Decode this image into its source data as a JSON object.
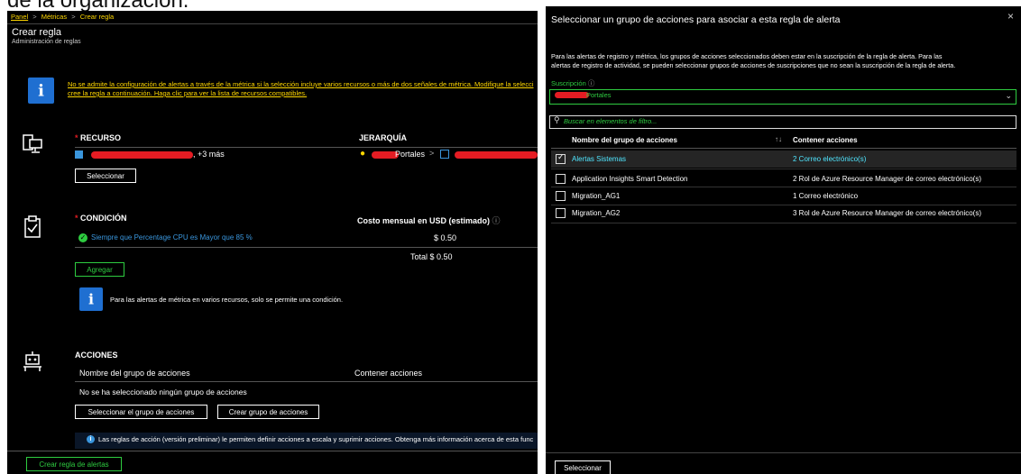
{
  "background_text": "de la organización.",
  "left": {
    "breadcrumb": {
      "panel": "Panel",
      "sep": ">",
      "metricas": "Métricas",
      "crear": "Crear regla"
    },
    "title": "Crear regla",
    "subtitle": "Administración de reglas",
    "info_link_line1": "No se admite la configuración de alertas a través de la métrica si la selección incluye varios recursos o más de dos señales de métrica. Modifique la selecci",
    "info_link_line2": "cree la regla a continuación. Haga clic para ver la lista de recursos compatibles.",
    "resource": {
      "header": "RECURSO",
      "hierarchy_header": "JERARQUÍA",
      "more": ", +3 más",
      "hierarchy_item": "Portales",
      "select_button": "Seleccionar"
    },
    "condition": {
      "header": "CONDICIÓN",
      "cost_header": "Costo mensual en USD (estimado)",
      "condition_text": "Siempre que Percentage CPU es Mayor que 85 %",
      "cost_value": "$ 0.50",
      "total": "Total $ 0.50",
      "add_button": "Agregar",
      "info_text": "Para las alertas de métrica en varios recursos, solo se permite una condición."
    },
    "actions": {
      "header": "ACCIONES",
      "col_name": "Nombre del grupo de acciones",
      "col_contains": "Contener acciones",
      "empty": "No se ha seleccionado ningún grupo de acciones",
      "select_group_button": "Seleccionar el grupo de acciones",
      "create_group_button": "Crear grupo de acciones",
      "note": "Las reglas de acción (versión preliminar) le permiten definir acciones a escala y suprimir acciones. Obtenga más información acerca de esta func"
    },
    "create_button": "Crear regla de alertas"
  },
  "right": {
    "title": "Seleccionar un grupo de acciones para asociar a esta regla de alerta",
    "description_line1": "Para las alertas de registro y métrica, los grupos de acciones seleccionados deben estar en la suscripción de la regla de alerta. Para las",
    "description_line2": "alertas de registro de actividad, se pueden seleccionar grupos de acciones de suscripciones que no sean la suscripción de la regla de alerta.",
    "subscription_label": "Suscripción",
    "subscription_value": "Portales",
    "search_placeholder": "Buscar en elementos de filtro...",
    "col_name": "Nombre del grupo de acciones",
    "col_contains": "Contener acciones",
    "rows": [
      {
        "name": "Alertas Sistemas",
        "actions": "2 Correo electrónico(s)",
        "selected": true
      },
      {
        "name": "Application Insights Smart Detection",
        "actions": "2 Rol de Azure Resource Manager de correo electrónico(s)",
        "selected": false
      },
      {
        "name": "Migration_AG1",
        "actions": "1 Correo electrónico",
        "selected": false
      },
      {
        "name": "Migration_AG2",
        "actions": "3 Rol de Azure Resource Manager de correo electrónico(s)",
        "selected": false
      }
    ],
    "select_button": "Seleccionar",
    "close_glyph": "×"
  },
  "colors": {
    "accent_green": "#2ecc40",
    "link_yellow": "#ffd700",
    "link_blue": "#3a96dd",
    "selected_cyan": "#50e6ff",
    "info_blue": "#1f6fd1",
    "redaction": "#e51c23"
  }
}
